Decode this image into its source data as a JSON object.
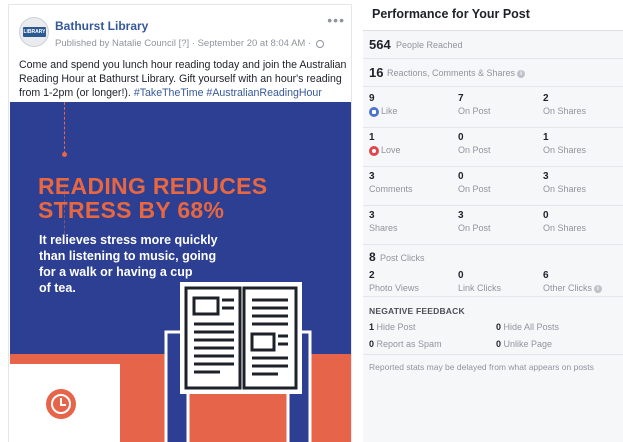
{
  "post": {
    "page_name": "Bathurst Library",
    "avatar_text": "LIBRARY",
    "published_by": "Published by Natalie Council",
    "badge": "[?]",
    "separator": "·",
    "timestamp": "September 20 at 8:04 AM ·",
    "more": "•••",
    "body": "Come and spend you lunch hour reading today and join the Australian Reading Hour at Bathurst Library. Gift yourself with an hour's reading from 1-2pm (or longer!). ",
    "hashtags": "#TakeTheTime #AustralianReadingHour",
    "image": {
      "headline": "READING REDUCES\nSTRESS BY 68%",
      "subtext": "It relieves stress more quickly\nthan listening to music, going\nfor a walk or having a cup\nof tea.",
      "colors": {
        "navy": "#2c3f93",
        "coral": "#e6654a",
        "white": "#ffffff"
      }
    }
  },
  "insights": {
    "title": "Performance for Your Post",
    "reached": {
      "value": "564",
      "label": "People Reached"
    },
    "engagements": {
      "value": "16",
      "label": "Reactions, Comments & Shares"
    },
    "rows": [
      {
        "c1": {
          "n": "9",
          "l": "Like"
        },
        "c2": {
          "n": "7",
          "l": "On Post"
        },
        "c3": {
          "n": "2",
          "l": "On Shares"
        }
      },
      {
        "c1": {
          "n": "1",
          "l": "Love"
        },
        "c2": {
          "n": "0",
          "l": "On Post"
        },
        "c3": {
          "n": "1",
          "l": "On Shares"
        }
      },
      {
        "c1": {
          "n": "3",
          "l": "Comments"
        },
        "c2": {
          "n": "0",
          "l": "On Post"
        },
        "c3": {
          "n": "3",
          "l": "On Shares"
        }
      },
      {
        "c1": {
          "n": "3",
          "l": "Shares"
        },
        "c2": {
          "n": "3",
          "l": "On Post"
        },
        "c3": {
          "n": "0",
          "l": "On Shares"
        }
      }
    ],
    "clicks": {
      "value": "8",
      "label": "Post Clicks",
      "items": [
        {
          "n": "2",
          "l": "Photo Views"
        },
        {
          "n": "0",
          "l": "Link Clicks"
        },
        {
          "n": "6",
          "l": "Other Clicks"
        }
      ]
    },
    "negative": {
      "heading": "NEGATIVE FEEDBACK",
      "hide_post": {
        "n": "1",
        "l": "Hide Post"
      },
      "hide_all": {
        "n": "0",
        "l": "Hide All Posts"
      },
      "spam": {
        "n": "0",
        "l": "Report as Spam"
      },
      "unlike": {
        "n": "0",
        "l": "Unlike Page"
      }
    },
    "footnote": "Reported stats may be delayed from what appears on posts",
    "info_glyph": "i"
  }
}
